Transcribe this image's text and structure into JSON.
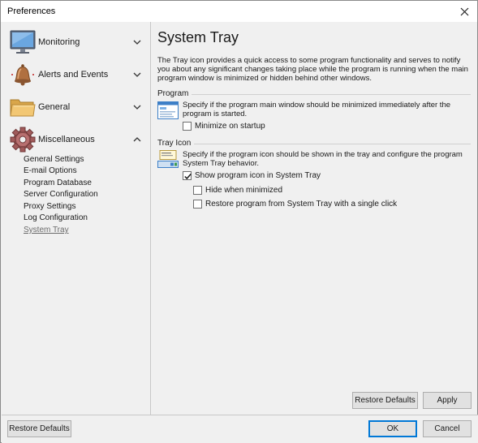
{
  "window": {
    "title": "Preferences"
  },
  "sidebar": {
    "categories": [
      {
        "label": "Monitoring",
        "icon": "monitor-icon",
        "expanded": false
      },
      {
        "label": "Alerts and Events",
        "icon": "bell-icon",
        "expanded": false
      },
      {
        "label": "General",
        "icon": "folder-icon",
        "expanded": false
      },
      {
        "label": "Miscellaneous",
        "icon": "gear-icon",
        "expanded": true
      }
    ],
    "misc_items": [
      {
        "label": "General Settings",
        "active": false
      },
      {
        "label": "E-mail Options",
        "active": false
      },
      {
        "label": "Program Database",
        "active": false
      },
      {
        "label": "Server Configuration",
        "active": false
      },
      {
        "label": "Proxy Settings",
        "active": false
      },
      {
        "label": "Log Configuration",
        "active": false
      },
      {
        "label": "System Tray",
        "active": true
      }
    ]
  },
  "page": {
    "title": "System Tray",
    "description": "The Tray icon provides a quick access to some program functionality and serves to notify you about any significant changes taking place while the program is running when the main program window is minimized or hidden behind other windows.",
    "program_group": {
      "label": "Program",
      "text": "Specify if the program main window should be minimized immediately after the program is started.",
      "minimize_on_startup": {
        "label": "Minimize on startup",
        "checked": false
      }
    },
    "tray_group": {
      "label": "Tray Icon",
      "text": "Specify if the program icon should be shown in the tray and configure the program System Tray behavior.",
      "show_icon": {
        "label": "Show program icon in System Tray",
        "checked": true
      },
      "hide_minimized": {
        "label": "Hide when minimized",
        "checked": false
      },
      "restore_single_click": {
        "label": "Restore program from System Tray with a single click",
        "checked": false
      }
    },
    "restore_defaults_label": "Restore Defaults",
    "apply_label": "Apply"
  },
  "footer": {
    "restore_defaults_label": "Restore Defaults",
    "ok_label": "OK",
    "cancel_label": "Cancel"
  },
  "colors": {
    "accent": "#0078d7",
    "background": "#f0f0f0",
    "active_link": "#6b6b6b"
  }
}
